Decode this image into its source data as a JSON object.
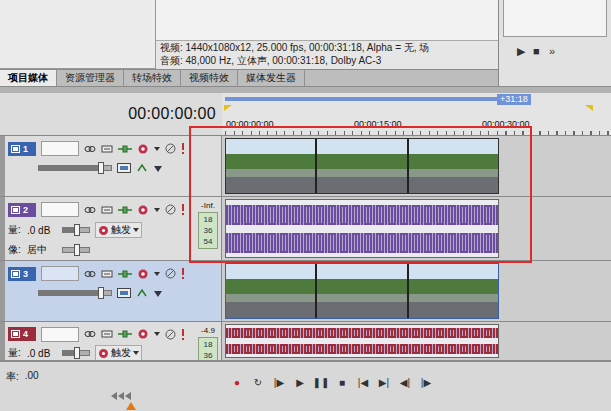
{
  "media_info": {
    "video": "视频: 1440x1080x12, 25.000 fps, 00:00:31:18, Alpha = 无, 场",
    "audio": "音频: 48,000 Hz, 立体声, 00:00:31:18, Dolby AC-3"
  },
  "preview_controls": [
    "▶",
    "■",
    "»"
  ],
  "tabs": [
    {
      "label": "项目媒体",
      "selected": true
    },
    {
      "label": "资源管理器",
      "selected": false
    },
    {
      "label": "转场特效",
      "selected": false
    },
    {
      "label": "视频特效",
      "selected": false
    },
    {
      "label": "媒体发生器",
      "selected": false
    }
  ],
  "timecode": "00:00:00:00",
  "ruler": {
    "marker": "+31:18",
    "labels": [
      "00:00:00:00",
      "00:00:15:00",
      "00:00:30:00"
    ]
  },
  "tracks": [
    {
      "number": "1",
      "kind": "video",
      "selected": false,
      "color": "#3b64b0",
      "level": 0.85
    },
    {
      "number": "2",
      "kind": "audio",
      "selected": false,
      "color": "#6a4d9e",
      "level": 0.5,
      "volume_label": "量:",
      "volume": ".0 dB",
      "trigger": "触发",
      "pan_label": "像:",
      "pan": "居中",
      "pan_level": 0.5,
      "meter_top": "-Inf.",
      "meter_scale": [
        "18",
        "36",
        "54"
      ]
    },
    {
      "number": "3",
      "kind": "video",
      "selected": true,
      "color": "#3b64b0",
      "level": 0.85
    },
    {
      "number": "4",
      "kind": "audio",
      "selected": false,
      "color": "#9a2c3c",
      "level": 0.5,
      "volume_label": "量:",
      "volume": ".0 dB",
      "trigger": "触发",
      "meter_top": "-4.9",
      "meter_scale": [
        "18",
        "36"
      ]
    }
  ],
  "rate": {
    "label": "率:",
    "value": ".00",
    "level": 0.5
  },
  "transport": [
    "●",
    "↻",
    "|▶",
    "▶",
    "❚❚",
    "■",
    "|◀",
    "▶|",
    "◀|",
    "|▶"
  ]
}
